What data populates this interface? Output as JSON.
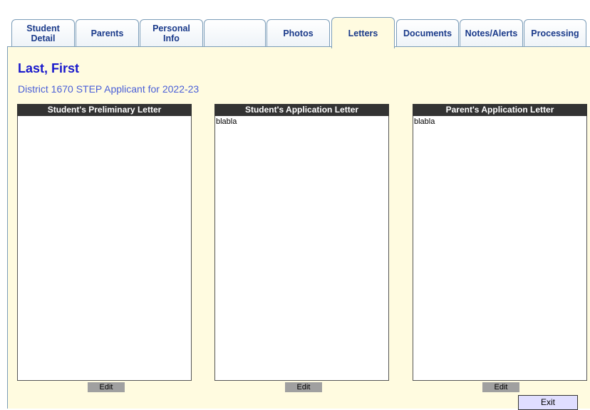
{
  "tabs": [
    {
      "label": "Student\nDetail",
      "active": false
    },
    {
      "label": "Parents",
      "active": false
    },
    {
      "label": "Personal\nInfo",
      "active": false
    },
    {
      "label": "",
      "active": false
    },
    {
      "label": "Photos",
      "active": false
    },
    {
      "label": "Letters",
      "active": true
    },
    {
      "label": "Documents",
      "active": false
    },
    {
      "label": "Notes/Alerts",
      "active": false
    },
    {
      "label": "Processing",
      "active": false
    }
  ],
  "student": {
    "name": "Last, First",
    "subtitle": "District 1670 STEP Applicant for 2022-23"
  },
  "panels": {
    "preliminary": {
      "title": "Student's Preliminary Letter",
      "body": "",
      "edit_label": "Edit"
    },
    "student_application": {
      "title": "Student's Application Letter",
      "body": "blabla",
      "edit_label": "Edit"
    },
    "parent_application": {
      "title": "Parent's Application Letter",
      "body": "blabla",
      "edit_label": "Edit"
    }
  },
  "exit_label": "Exit",
  "colors": {
    "content_bg": "#fffbe0",
    "tab_text": "#1a3a8a",
    "name_color": "#1818cc",
    "subtitle_color": "#4a5fd8",
    "header_bg": "#333333",
    "edit_bg": "#a0a0a0",
    "exit_bg": "#e0deff"
  }
}
